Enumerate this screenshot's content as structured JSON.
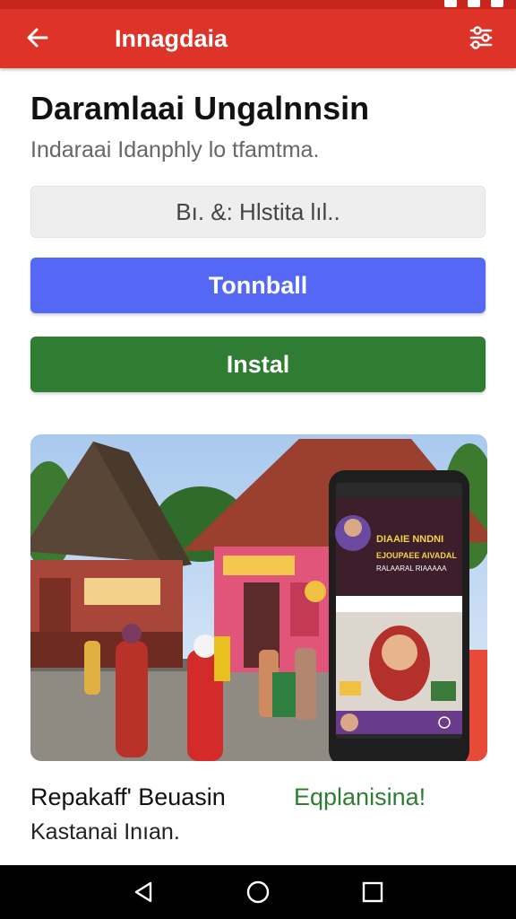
{
  "app_bar": {
    "title": "Innagdaia",
    "back_icon": "arrow-left-icon",
    "action_icon": "filter-settings-icon",
    "color": "#dd3329"
  },
  "header": {
    "title": "Daramlaai Ungalnnsin",
    "subtitle": "Indaraai Idanphly lo tfamtma."
  },
  "search": {
    "value": "Bı. &: Hlstita lıl.."
  },
  "buttons": {
    "primary_label": "Tonnball",
    "primary_color": "#5468f5",
    "install_label": "Instal",
    "install_color": "#2e7d32"
  },
  "hero": {
    "screen_headline_1": "DIAAIE NNDNI",
    "screen_headline_2": "EJOUPAEE AIVADAL",
    "screen_headline_3": "RALAARAL RIAAAAA"
  },
  "caption": {
    "title": "Repakaff' Beuasin",
    "link": "Eqplanisina!",
    "subtitle": "Kastanai Inıan."
  },
  "nav_bar": {
    "back_icon": "triangle-back-icon",
    "home_icon": "circle-home-icon",
    "recents_icon": "square-recents-icon"
  }
}
